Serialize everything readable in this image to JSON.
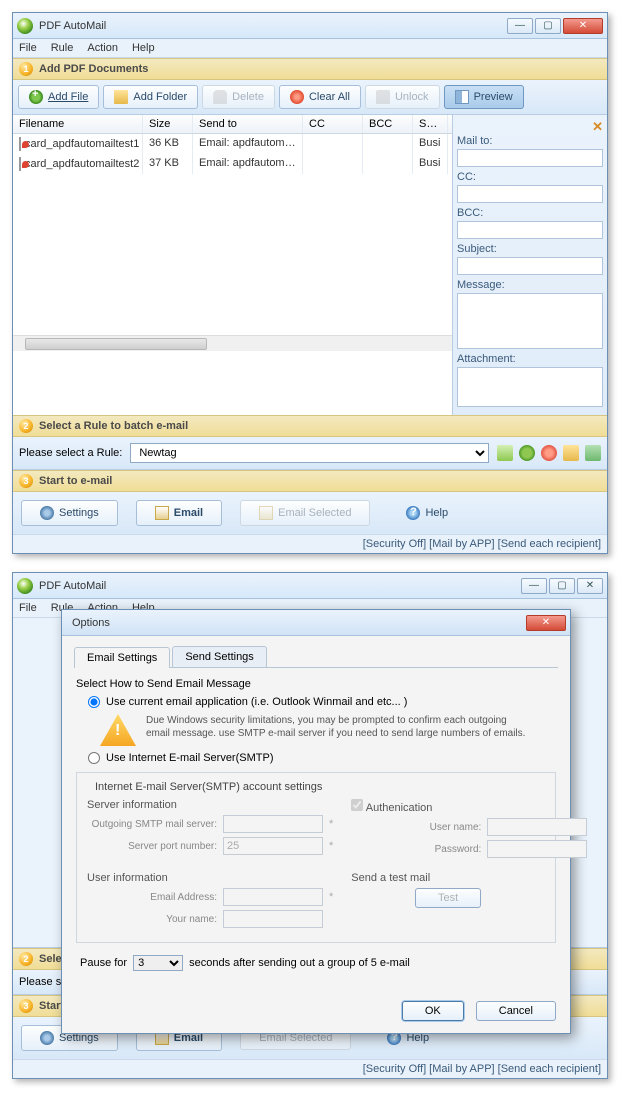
{
  "app_title": "PDF AutoMail",
  "menus": [
    "File",
    "Rule",
    "Action",
    "Help"
  ],
  "section1": "Add PDF Documents",
  "toolbar": {
    "add_file": "Add File",
    "add_folder": "Add Folder",
    "delete": "Delete",
    "clear_all": "Clear All",
    "unlock": "Unlock",
    "preview": "Preview"
  },
  "columns": {
    "fn": "Filename",
    "sz": "Size",
    "st": "Send to",
    "cc": "CC",
    "bcc": "BCC",
    "sj": "Subj"
  },
  "rows": [
    {
      "fn": "card_apdfautomailtest1",
      "sz": "36 KB",
      "st": "Email: apdfautomail...",
      "cc": "",
      "bcc": "",
      "sj": "Busi"
    },
    {
      "fn": "card_apdfautomailtest2",
      "sz": "37 KB",
      "st": "Email: apdfautomail...",
      "cc": "",
      "bcc": "",
      "sj": "Busi"
    }
  ],
  "side": {
    "mailto": "Mail to:",
    "cc": "CC:",
    "bcc": "BCC:",
    "subject": "Subject:",
    "message": "Message:",
    "attachment": "Attachment:"
  },
  "section2": "Select a Rule to batch e-mail",
  "rule_label": "Please select a Rule:",
  "rule_value": "Newtag",
  "section3": "Start to e-mail",
  "bottom": {
    "settings": "Settings",
    "email": "Email",
    "email_selected": "Email Selected",
    "help": "Help"
  },
  "status": "[Security Off]  [Mail by APP]  [Send each recipient]",
  "dialog": {
    "title": "Options",
    "tabs": [
      "Email Settings",
      "Send Settings"
    ],
    "section_label": "Select How to Send Email Message",
    "radio1": "Use current email application (i.e. Outlook Winmail and etc... )",
    "warn": "Due Windows security limitations,  you may be prompted to confirm each outgoing email message. use SMTP e-mail server if you need to send large numbers of emails.",
    "radio2": "Use Internet E-mail Server(SMTP)",
    "fs_title": "Internet E-mail Server(SMTP) account settings",
    "server_info": "Server information",
    "smtp_label": "Outgoing SMTP mail server:",
    "port_label": "Server port number:",
    "port_value": "25",
    "auth": "Authenication",
    "user_label": "User name:",
    "pass_label": "Password:",
    "user_info": "User information",
    "email_addr": "Email Address:",
    "your_name": "Your name:",
    "test_title": "Send a test mail",
    "test_btn": "Test",
    "pause_pre": "Pause for",
    "pause_val": "3",
    "pause_post": "seconds after sending out a group of 5 e-mail",
    "ok": "OK",
    "cancel": "Cancel"
  }
}
